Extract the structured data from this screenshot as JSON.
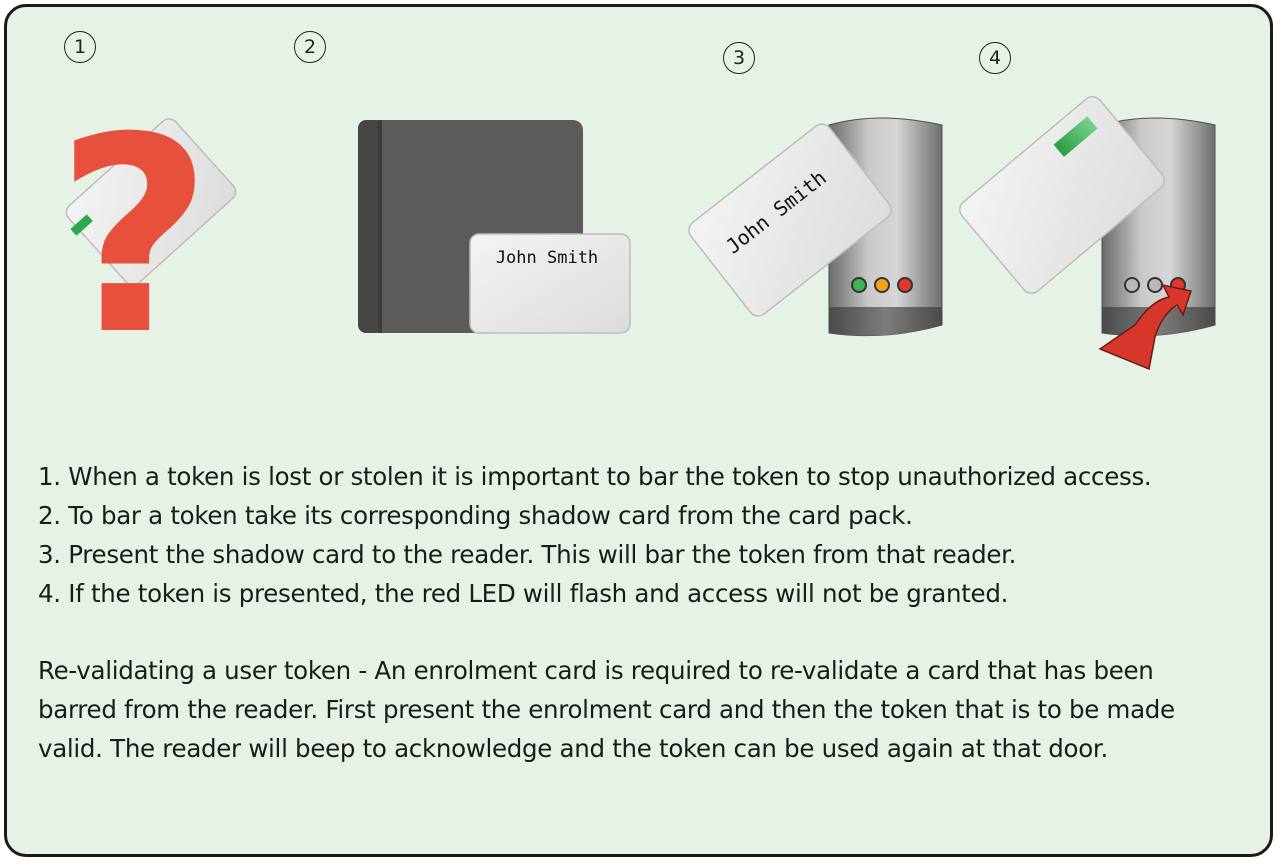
{
  "steps": {
    "markers": [
      "1",
      "2",
      "3",
      "4"
    ],
    "items": [
      "1. When a token is lost or stolen it is important to bar the token to stop unauthorized access.",
      "2. To bar a token take its corresponding shadow card from the card pack.",
      "3. Present the shadow card to the reader. This will bar the token from that reader.",
      "4. If the token is presented, the red LED will flash and access will not be granted."
    ]
  },
  "revalidate": {
    "text": "Re-validating a user token - An enrolment card is required to re-validate a card that has been barred from the reader. First present the enrolment card and then the token that is to be made valid. The reader will beep to acknowledge and the token can be used again at that door."
  },
  "illustrations": {
    "question_mark": "?",
    "shadow_card_name": "John Smith",
    "presented_card_name": "John Smith"
  },
  "colors": {
    "panel_bg": "#e6f2e6",
    "question_mark": "#e8503e",
    "token_chip": "#2ea84a",
    "led_green": "#3fb34f",
    "led_amber": "#f2a21b",
    "led_red": "#e0392b",
    "arrow": "#d8382c",
    "card_pack": "#5a5a5a"
  }
}
